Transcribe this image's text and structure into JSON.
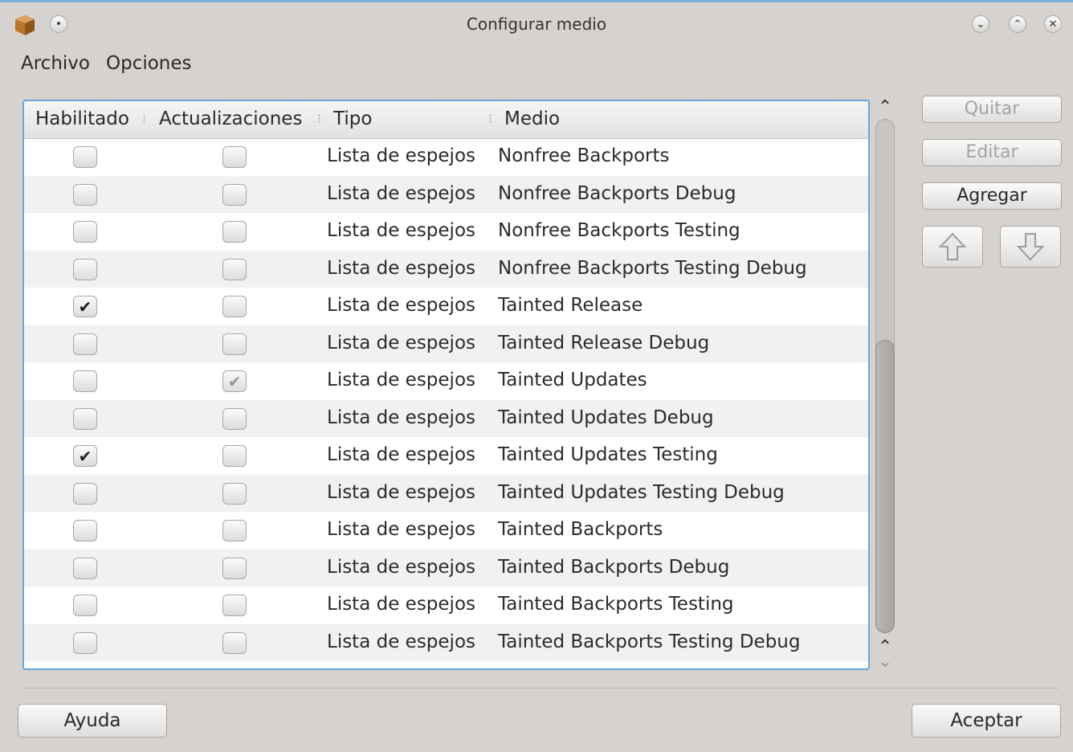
{
  "window": {
    "title": "Configurar medio"
  },
  "menu": [
    "Archivo",
    "Opciones"
  ],
  "columns": [
    "Habilitado",
    "Actualizaciones",
    "Tipo",
    "Medio"
  ],
  "rows": [
    {
      "enabled": false,
      "updates": false,
      "type": "Lista de espejos",
      "medium": "Nonfree Backports"
    },
    {
      "enabled": false,
      "updates": false,
      "type": "Lista de espejos",
      "medium": "Nonfree Backports Debug"
    },
    {
      "enabled": false,
      "updates": false,
      "type": "Lista de espejos",
      "medium": "Nonfree Backports Testing"
    },
    {
      "enabled": false,
      "updates": false,
      "type": "Lista de espejos",
      "medium": "Nonfree Backports Testing Debug"
    },
    {
      "enabled": true,
      "updates": false,
      "type": "Lista de espejos",
      "medium": "Tainted Release"
    },
    {
      "enabled": false,
      "updates": false,
      "type": "Lista de espejos",
      "medium": "Tainted Release Debug"
    },
    {
      "enabled": false,
      "updates": true,
      "updates_dim": true,
      "type": "Lista de espejos",
      "medium": "Tainted Updates"
    },
    {
      "enabled": false,
      "updates": false,
      "type": "Lista de espejos",
      "medium": "Tainted Updates Debug"
    },
    {
      "enabled": true,
      "updates": false,
      "type": "Lista de espejos",
      "medium": "Tainted Updates Testing"
    },
    {
      "enabled": false,
      "updates": false,
      "type": "Lista de espejos",
      "medium": "Tainted Updates Testing Debug"
    },
    {
      "enabled": false,
      "updates": false,
      "type": "Lista de espejos",
      "medium": "Tainted Backports"
    },
    {
      "enabled": false,
      "updates": false,
      "type": "Lista de espejos",
      "medium": "Tainted Backports Debug"
    },
    {
      "enabled": false,
      "updates": false,
      "type": "Lista de espejos",
      "medium": "Tainted Backports Testing"
    },
    {
      "enabled": false,
      "updates": false,
      "type": "Lista de espejos",
      "medium": "Tainted Backports Testing Debug"
    }
  ],
  "buttons": {
    "remove": "Quitar",
    "edit": "Editar",
    "add": "Agregar",
    "help": "Ayuda",
    "ok": "Aceptar"
  },
  "icons": {
    "app": "package-icon",
    "move_up": "arrow-up-icon",
    "move_down": "arrow-down-icon"
  },
  "scroll": {
    "position_fraction": 1.0
  },
  "colors": {
    "accent": "#68a8dc",
    "background": "#d6d2d0"
  }
}
